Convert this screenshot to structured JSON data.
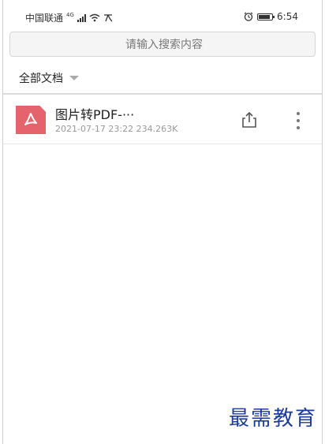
{
  "status_bar": {
    "carrier": "中国联通",
    "network": "4G",
    "wifi_icon": "wifi-icon",
    "extra_icon": "nfc-icon",
    "alarm_icon": "alarm-icon",
    "battery_level": 0.9,
    "time": "6:54"
  },
  "search": {
    "placeholder": "请输入搜索内容"
  },
  "filter": {
    "label": "全部文档",
    "icon": "caret-down-icon"
  },
  "files": [
    {
      "icon": "pdf-file-icon",
      "name": "图片转PDF-···",
      "meta": "2021-07-17 23:22 234.263K",
      "share_icon": "share-icon",
      "more_icon": "more-vertical-icon"
    }
  ],
  "watermark": "最需教育",
  "colors": {
    "pdf_red": "#e4636c",
    "watermark_blue": "#1d3b9a"
  }
}
